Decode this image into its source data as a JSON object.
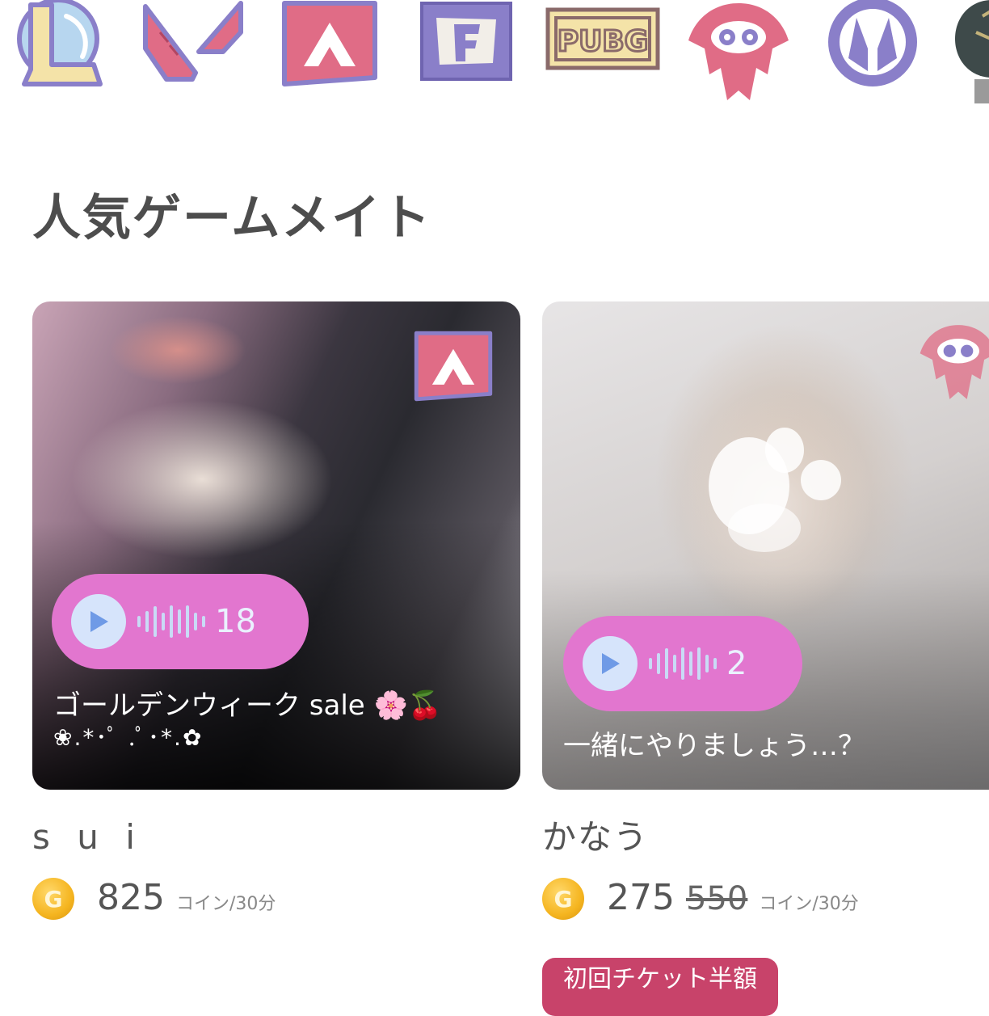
{
  "game_icons": [
    {
      "name": "League of Legends",
      "icon": "lol-icon"
    },
    {
      "name": "VALORANT",
      "icon": "valorant-icon"
    },
    {
      "name": "Apex Legends",
      "icon": "apex-icon"
    },
    {
      "name": "Fortnite",
      "icon": "fortnite-icon"
    },
    {
      "name": "PUBG",
      "icon": "pubg-icon",
      "label": "PUBG"
    },
    {
      "name": "Splatoon",
      "icon": "splatoon-icon"
    },
    {
      "name": "Overwatch",
      "icon": "overwatch-icon"
    },
    {
      "name": "partial game",
      "icon": "game-icon"
    }
  ],
  "colors": {
    "accent_pink": "#e276cf",
    "icon_pink": "#e06c86",
    "icon_purple": "#8a7fc9",
    "ticket_red": "#c8436a",
    "coin_gold": "#f5b520"
  },
  "section": {
    "title": "人気ゲームメイト"
  },
  "mates": [
    {
      "name": "s u i",
      "game_icon": "apex-icon",
      "voice_count": "18",
      "message_line1": "ゴールデンウィーク sale 🌸🍒",
      "message_line2": "❀.*･ﾟ .ﾟ･*.✿",
      "price": "825",
      "unit": "コイン/30分"
    },
    {
      "name": "かなう",
      "game_icon": "splatoon-icon",
      "voice_count": "2",
      "message_line1": "一緒にやりましょう…？",
      "price": "275",
      "price_original": "550",
      "unit": "コイン/30分",
      "badge": "初回チケット半額"
    }
  ]
}
